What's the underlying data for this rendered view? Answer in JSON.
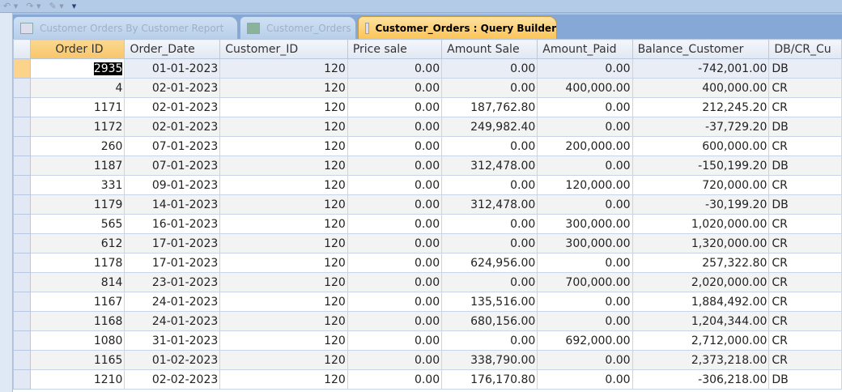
{
  "toolbar": {
    "icons": [
      "undo-icon",
      "redo-icon",
      "spelling-icon",
      "customize-arrow-icon"
    ]
  },
  "tabs": [
    {
      "label": "Customer Orders By Customer Report",
      "icon": "report-icon",
      "active": false
    },
    {
      "label": "Customer_Orders",
      "icon": "table-icon",
      "active": false
    },
    {
      "label": "Customer_Orders : Query Builder",
      "icon": "query-icon",
      "active": true
    }
  ],
  "columns": [
    "Order ID",
    "Order_Date",
    "Customer_ID",
    "Price sale",
    "Amount Sale",
    "Amount_Paid",
    "Balance_Customer",
    "DB/CR_Cu"
  ],
  "rows": [
    [
      "2935",
      "01-01-2023",
      "120",
      "0.00",
      "0.00",
      "0.00",
      "-742,001.00",
      "DB"
    ],
    [
      "4",
      "02-01-2023",
      "120",
      "0.00",
      "0.00",
      "400,000.00",
      "400,000.00",
      "CR"
    ],
    [
      "1171",
      "02-01-2023",
      "120",
      "0.00",
      "187,762.80",
      "0.00",
      "212,245.20",
      "CR"
    ],
    [
      "1172",
      "02-01-2023",
      "120",
      "0.00",
      "249,982.40",
      "0.00",
      "-37,729.20",
      "DB"
    ],
    [
      "260",
      "07-01-2023",
      "120",
      "0.00",
      "0.00",
      "200,000.00",
      "600,000.00",
      "CR"
    ],
    [
      "1187",
      "07-01-2023",
      "120",
      "0.00",
      "312,478.00",
      "0.00",
      "-150,199.20",
      "DB"
    ],
    [
      "331",
      "09-01-2023",
      "120",
      "0.00",
      "0.00",
      "120,000.00",
      "720,000.00",
      "CR"
    ],
    [
      "1179",
      "14-01-2023",
      "120",
      "0.00",
      "312,478.00",
      "0.00",
      "-30,199.20",
      "DB"
    ],
    [
      "565",
      "16-01-2023",
      "120",
      "0.00",
      "0.00",
      "300,000.00",
      "1,020,000.00",
      "CR"
    ],
    [
      "612",
      "17-01-2023",
      "120",
      "0.00",
      "0.00",
      "300,000.00",
      "1,320,000.00",
      "CR"
    ],
    [
      "1178",
      "17-01-2023",
      "120",
      "0.00",
      "624,956.00",
      "0.00",
      "257,322.80",
      "CR"
    ],
    [
      "814",
      "23-01-2023",
      "120",
      "0.00",
      "0.00",
      "700,000.00",
      "2,020,000.00",
      "CR"
    ],
    [
      "1167",
      "24-01-2023",
      "120",
      "0.00",
      "135,516.00",
      "0.00",
      "1,884,492.00",
      "CR"
    ],
    [
      "1168",
      "24-01-2023",
      "120",
      "0.00",
      "680,156.00",
      "0.00",
      "1,204,344.00",
      "CR"
    ],
    [
      "1080",
      "31-01-2023",
      "120",
      "0.00",
      "0.00",
      "692,000.00",
      "2,712,000.00",
      "CR"
    ],
    [
      "1165",
      "01-02-2023",
      "120",
      "0.00",
      "338,790.00",
      "0.00",
      "2,373,218.00",
      "CR"
    ],
    [
      "1210",
      "02-02-2023",
      "120",
      "0.00",
      "176,170.80",
      "0.00",
      "-306,218.00",
      "DB"
    ]
  ]
}
